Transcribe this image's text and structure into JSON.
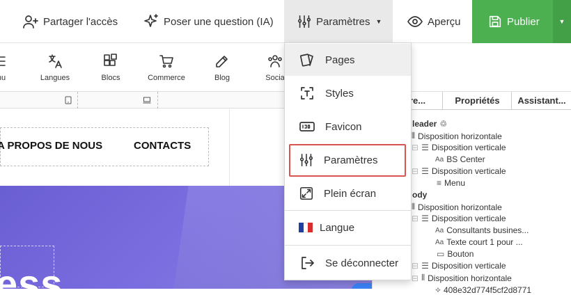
{
  "topbar": {
    "share_label": "Partager l'accès",
    "ask_label": "Poser une question (IA)",
    "params_label": "Paramètres",
    "preview_label": "Aperçu",
    "publish_label": "Publier"
  },
  "toolbar": {
    "items": [
      {
        "label": "enu",
        "icon": "menu-icon"
      },
      {
        "label": "Langues",
        "icon": "translate-icon"
      },
      {
        "label": "Blocs",
        "icon": "blocks-icon"
      },
      {
        "label": "Commerce",
        "icon": "cart-icon"
      },
      {
        "label": "Blog",
        "icon": "pen-icon"
      },
      {
        "label": "Socia",
        "icon": "social-icon"
      }
    ]
  },
  "canvas": {
    "nav_links": [
      "A PROPOS DE NOUS",
      "CONTACTS"
    ],
    "hero_text": "ess"
  },
  "panel": {
    "tabs": [
      "re...",
      "Propriétés",
      "Assistant..."
    ],
    "tree": [
      {
        "label": "leader",
        "head": true
      },
      {
        "label": "Disposition horizontale"
      },
      {
        "label": "Disposition verticale"
      },
      {
        "label": "BS Center"
      },
      {
        "label": "Disposition verticale"
      },
      {
        "label": "Menu"
      },
      {
        "label": "ody",
        "head": true
      },
      {
        "label": "Disposition horizontale"
      },
      {
        "label": "Disposition verticale"
      },
      {
        "label": "Consultants busines..."
      },
      {
        "label": "Texte court 1 pour ..."
      },
      {
        "label": "Bouton"
      },
      {
        "label": "Disposition verticale"
      },
      {
        "label": "Disposition horizontale"
      },
      {
        "label": "408e32d774f5cf2d8771"
      }
    ]
  },
  "dropdown": {
    "items": [
      {
        "label": "Pages",
        "icon": "pages-icon",
        "active": true
      },
      {
        "label": "Styles",
        "icon": "styles-icon"
      },
      {
        "label": "Favicon",
        "icon": "favicon-icon"
      },
      {
        "label": "Paramètres",
        "icon": "sliders-icon",
        "highlighted": true
      },
      {
        "label": "Plein écran",
        "icon": "fullscreen-icon"
      },
      {
        "label": "Langue",
        "icon": "flag-fr-icon"
      },
      {
        "label": "Se déconnecter",
        "icon": "logout-icon"
      }
    ]
  },
  "colors": {
    "publish": "#4caf50",
    "highlight": "#d9534f",
    "hero": "#6a5ed3"
  }
}
